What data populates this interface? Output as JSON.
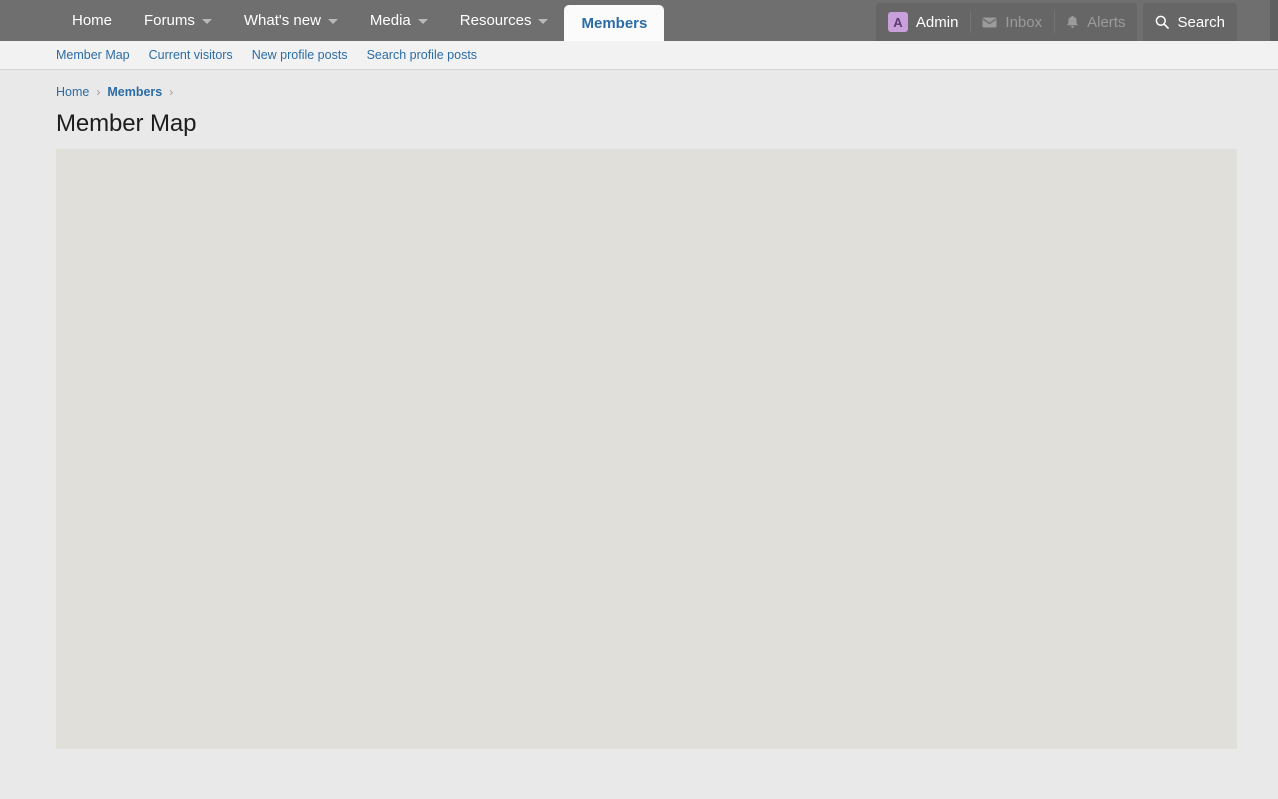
{
  "navbar": {
    "items": [
      {
        "label": "Home",
        "has_caret": false,
        "active": false
      },
      {
        "label": "Forums",
        "has_caret": true,
        "active": false
      },
      {
        "label": "What's new",
        "has_caret": true,
        "active": false
      },
      {
        "label": "Media",
        "has_caret": true,
        "active": false
      },
      {
        "label": "Resources",
        "has_caret": true,
        "active": false
      },
      {
        "label": "Members",
        "has_caret": false,
        "active": true
      }
    ],
    "user": {
      "avatar_initial": "A",
      "name": "Admin",
      "avatar_color": "#c9a0dc"
    },
    "inbox_label": "Inbox",
    "alerts_label": "Alerts",
    "search_label": "Search",
    "background_color": "#6f6f6f",
    "active_tab_color": "#2c6ca5"
  },
  "subnav": {
    "items": [
      {
        "label": "Member Map"
      },
      {
        "label": "Current visitors"
      },
      {
        "label": "New profile posts"
      },
      {
        "label": "Search profile posts"
      }
    ],
    "link_color": "#2c6ca5",
    "background_color": "#f2f2f2"
  },
  "breadcrumb": {
    "items": [
      {
        "label": "Home",
        "current": false
      },
      {
        "label": "Members",
        "current": true
      }
    ],
    "separator": "›"
  },
  "main": {
    "title": "Member Map",
    "map_placeholder_color": "#e0dfda",
    "page_background_color": "#e9e9e9"
  }
}
